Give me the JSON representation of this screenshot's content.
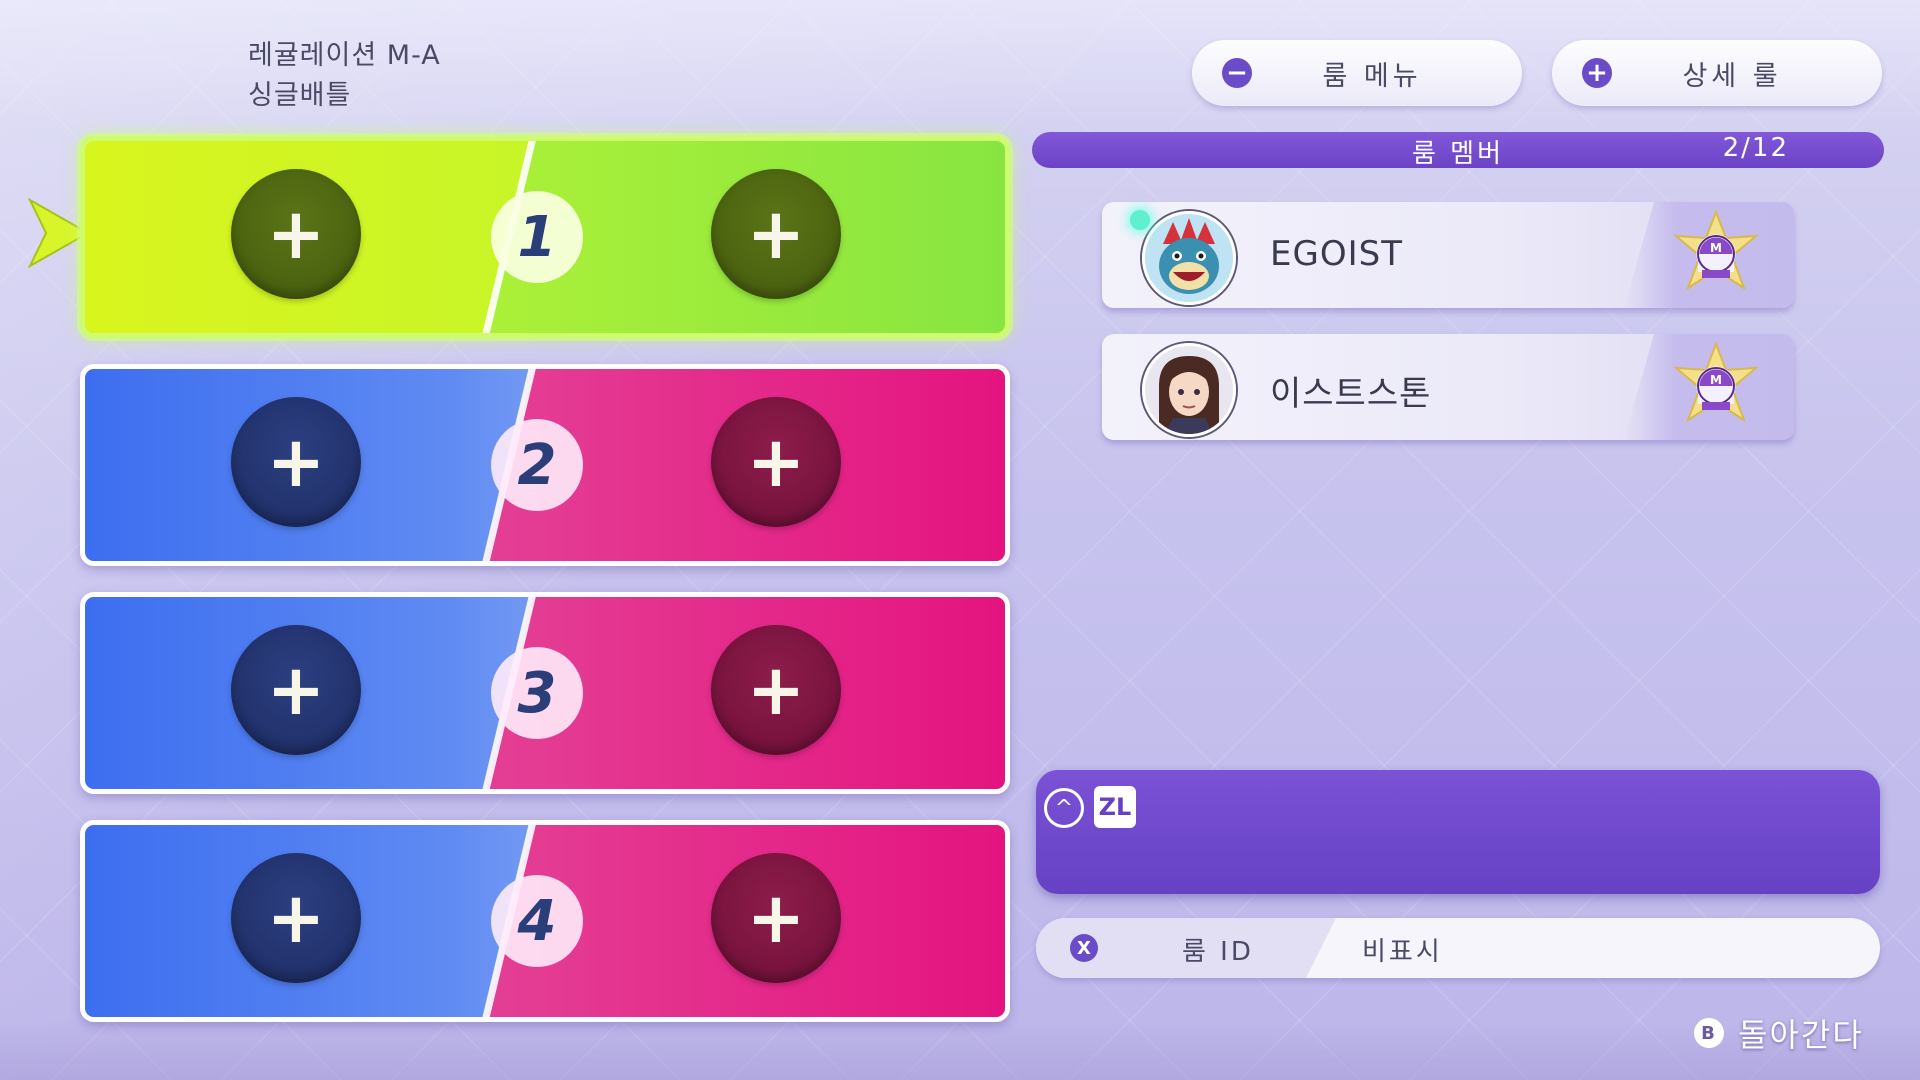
{
  "rules": {
    "regulation": "레귤레이션 M-A",
    "format": "싱글배틀"
  },
  "top_buttons": {
    "room_menu": {
      "icon": "minus-icon",
      "icon_glyph": "−",
      "label": "룸 메뉴"
    },
    "detail_rules": {
      "icon": "plus-icon",
      "icon_glyph": "+",
      "label": "상세 룰"
    }
  },
  "members": {
    "title": "룸 멤버",
    "count": "2/12",
    "list": [
      {
        "name": "EGOIST",
        "avatar": "feraligatr-avatar",
        "badge": "master-ball-rank-badge",
        "online": true
      },
      {
        "name": "이스트스톤",
        "avatar": "trainer-girl-avatar",
        "badge": "master-ball-rank-badge",
        "online": false
      }
    ]
  },
  "slots": [
    {
      "number": "1",
      "left_add": "+",
      "right_add": "+",
      "selected": true
    },
    {
      "number": "2",
      "left_add": "+",
      "right_add": "+",
      "selected": false
    },
    {
      "number": "3",
      "left_add": "+",
      "right_add": "+",
      "selected": false
    },
    {
      "number": "4",
      "left_add": "+",
      "right_add": "+",
      "selected": false
    }
  ],
  "chat": {
    "up_glyph": "^",
    "button_label": "ZL"
  },
  "room_id": {
    "button": "X",
    "label": "룸 ID",
    "value": "비표시"
  },
  "back": {
    "button": "B",
    "label": "돌아간다"
  },
  "colors": {
    "accent_purple": "#6c43c6",
    "team_blue": "#3d6ef0",
    "team_pink": "#e4147f",
    "selected_green": "#c9f527"
  }
}
